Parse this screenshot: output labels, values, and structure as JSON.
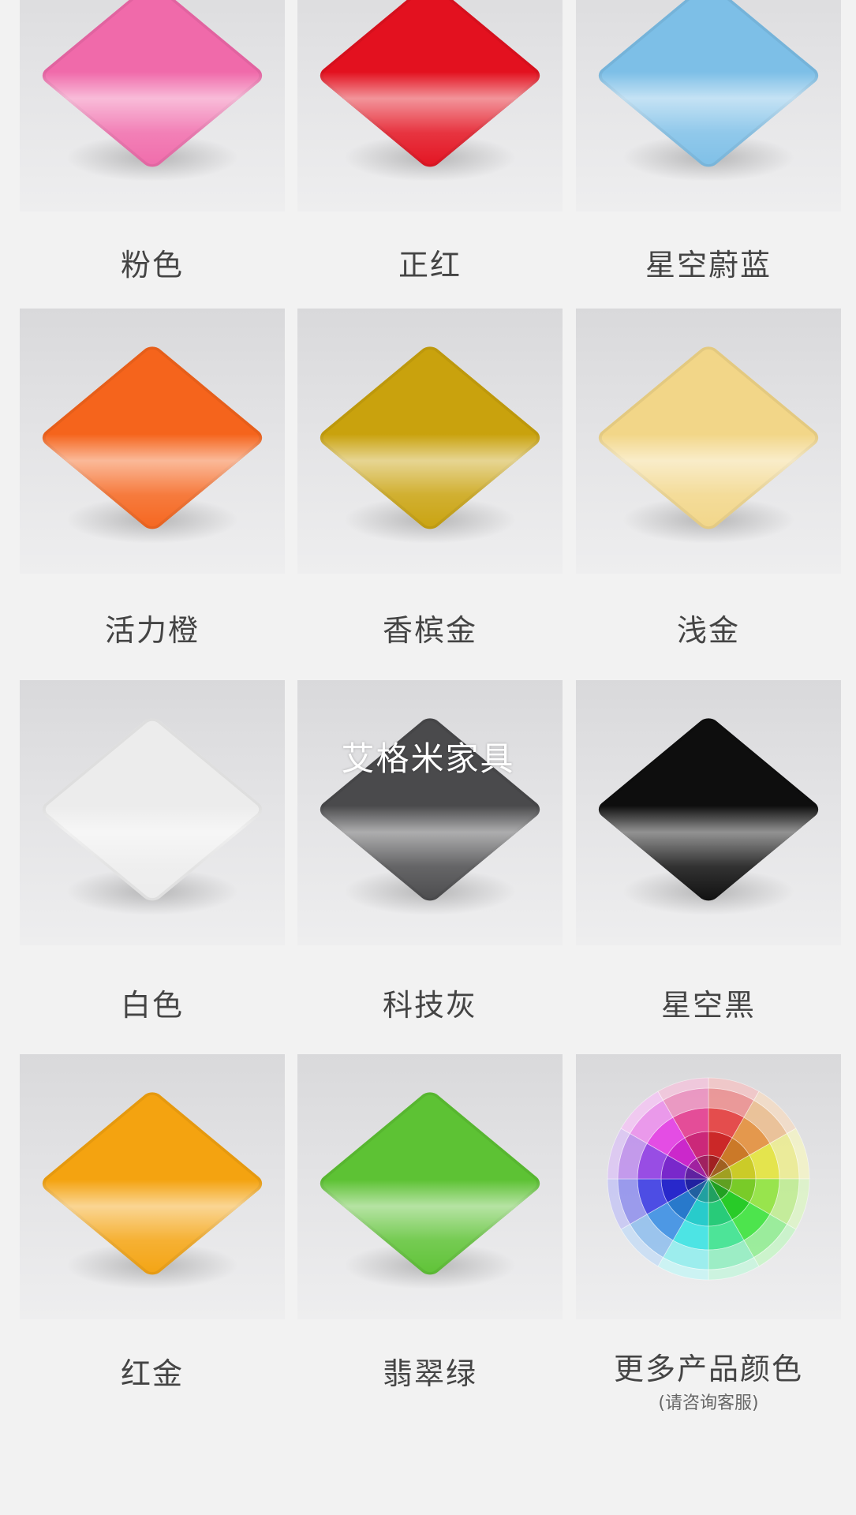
{
  "watermark": "艾格米家具",
  "swatches": [
    {
      "label": "粉色",
      "color": "#f06aaa"
    },
    {
      "label": "正红",
      "color": "#e3111f"
    },
    {
      "label": "星空蔚蓝",
      "color": "#7dbfe7"
    },
    {
      "label": "活力橙",
      "color": "#f5641c"
    },
    {
      "label": "香槟金",
      "color": "#c9a20d"
    },
    {
      "label": "浅金",
      "color": "#f2d688"
    },
    {
      "label": "白色",
      "color": "#ececec"
    },
    {
      "label": "科技灰",
      "color": "#4a4a4c"
    },
    {
      "label": "星空黑",
      "color": "#0e0e0e"
    },
    {
      "label": "红金",
      "color": "#f4a310"
    },
    {
      "label": "翡翠绿",
      "color": "#5dc234"
    }
  ],
  "more": {
    "label": "更多产品颜色",
    "sublabel": "(请咨询客服)",
    "icon": "color-wheel-icon"
  }
}
